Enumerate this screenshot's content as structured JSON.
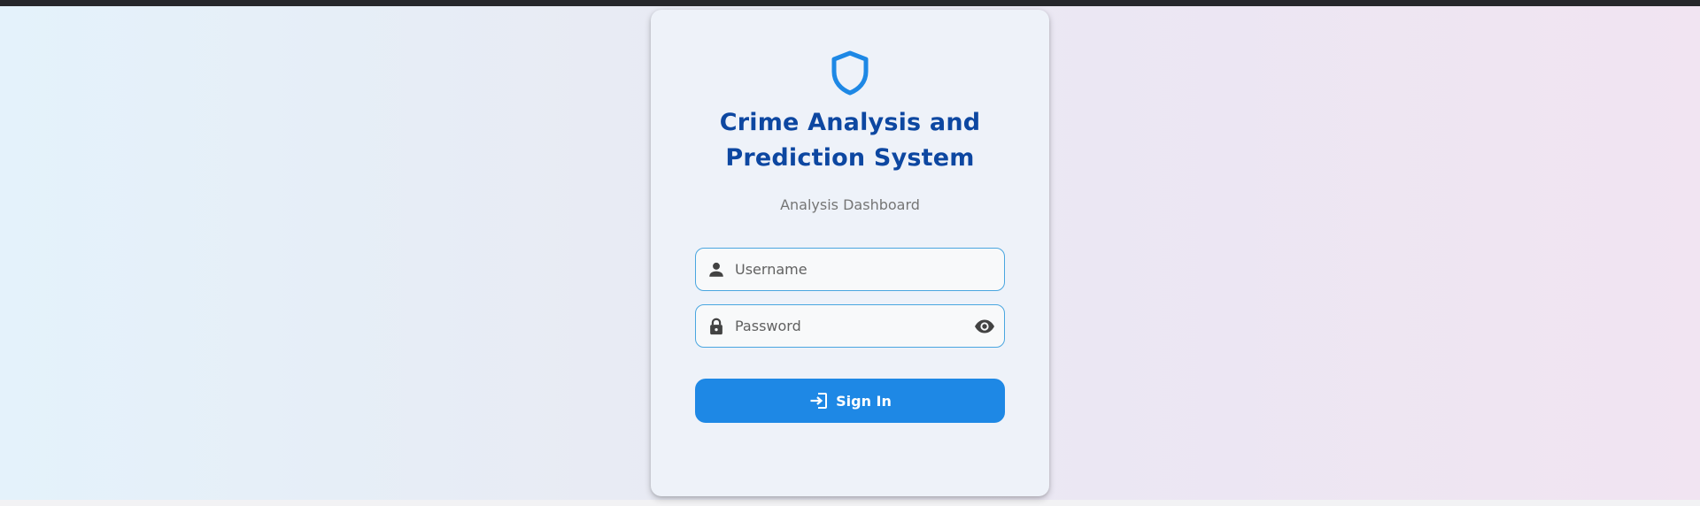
{
  "login": {
    "title_line1": "Crime Analysis and",
    "title_line2": "Prediction System",
    "subtitle": "Analysis Dashboard",
    "username": {
      "placeholder": "Username",
      "value": ""
    },
    "password": {
      "placeholder": "Password",
      "value": ""
    },
    "signin_label": "Sign In"
  },
  "icons": {
    "logo": "shield-icon",
    "username": "person-icon",
    "password": "lock-icon",
    "toggle_password": "eye-icon",
    "signin": "login-icon"
  },
  "colors": {
    "primary": "#1e88e5",
    "title": "#0d47a1",
    "input_border": "#4aa6e0",
    "subtitle": "#757575"
  }
}
